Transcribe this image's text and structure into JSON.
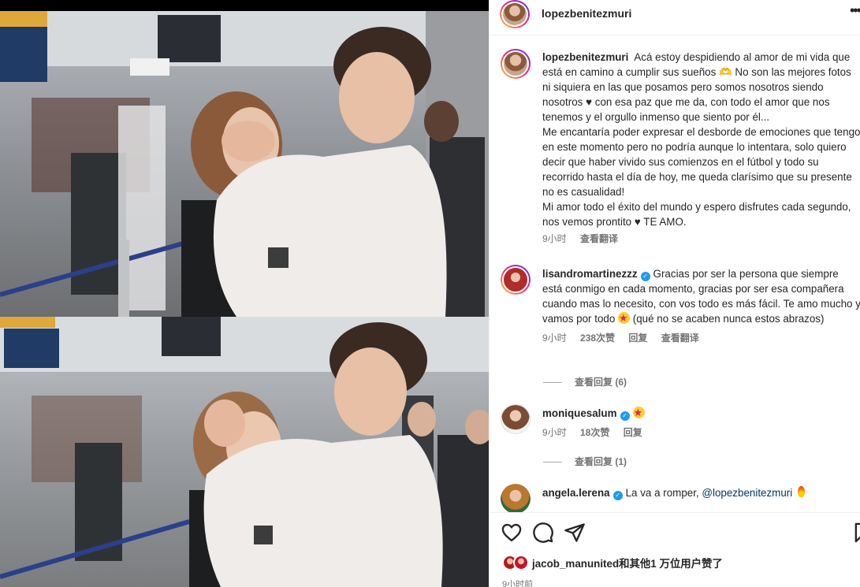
{
  "post": {
    "author": "lopezbenitezmuri",
    "more_label": "•••"
  },
  "caption": {
    "username": "lopezbenitezmuri",
    "text": "Acá estoy despidiendo al amor de mi vida que está en camino a cumplir sus sueños 🫶 No son las mejores fotos ni siquiera en las que posamos pero somos nosotros siendo nosotros ♥ con esa paz que me da, con todo el amor que nos tenemos y el orgullo inmenso que siento por él...",
    "text2": "Me encantaría poder expresar el desborde de emociones que tengo en este momento pero no podría aunque lo intentara, solo quiero decir que haber vivido sus comienzos en el fútbol y todo su recorrido hasta el día de hoy, me queda clarísimo que su presente no es casualidad!",
    "text3": "Mi amor todo el éxito del mundo y espero disfrutes cada segundo, nos vemos prontito ♥ TE AMO.",
    "time": "9小时",
    "translate": "查看翻译"
  },
  "comments": [
    {
      "username": "lisandromartinezzz",
      "verified": true,
      "text": "Gracias por ser la persona que siempre está conmigo en cada momento, gracias por ser esa compañera cuando mas lo necesito, con vos todo es más fácil. Te amo mucho y vamos por todo",
      "text_after": "(qué no se acaben nunca estos abrazos)",
      "time": "9小时",
      "likes": "238次赞",
      "reply": "回复",
      "translate": "查看翻译",
      "view_replies": "查看回复 (6)"
    },
    {
      "username": "moniquesalum",
      "verified": true,
      "time": "9小时",
      "likes": "18次赞",
      "reply": "回复",
      "view_replies": "查看回复 (1)"
    },
    {
      "username": "angela.lerena",
      "verified": true,
      "text": "La va a romper,",
      "mention": "@lopezbenitezmuri"
    }
  ],
  "footer": {
    "liked_by": "jacob_manunited和其他1 万位用户赞了",
    "time": "9小时前"
  },
  "icons": {
    "like": "heart-icon",
    "comment": "comment-icon",
    "share": "paper-plane-icon",
    "save": "bookmark-icon",
    "verified": "verified-badge-icon"
  },
  "colors": {
    "text": "#262626",
    "muted": "#737373",
    "link": "#00376b",
    "verified": "#1d9bf0"
  }
}
